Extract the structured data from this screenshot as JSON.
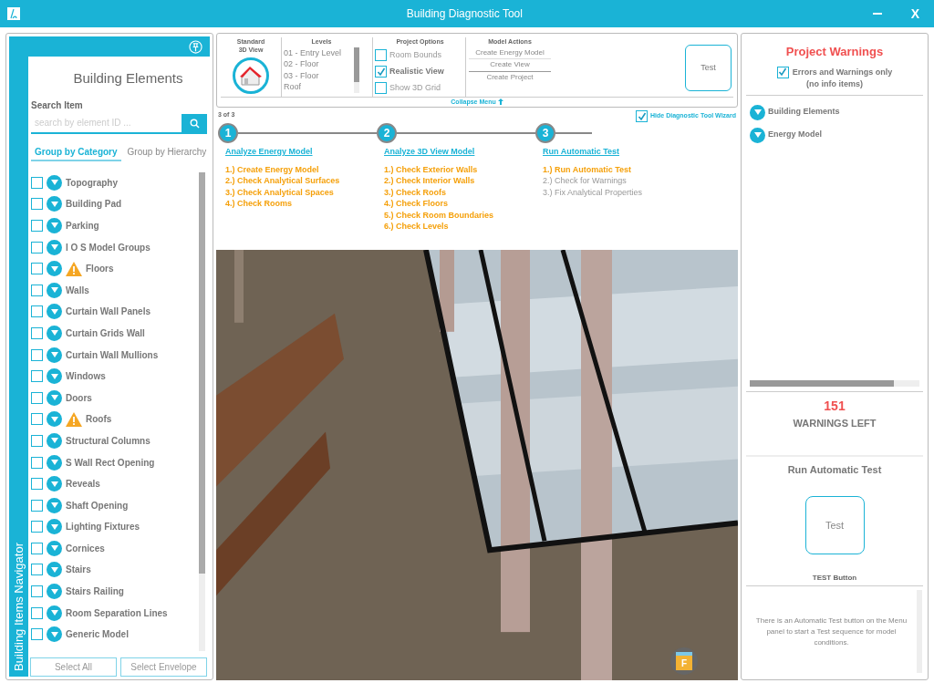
{
  "window": {
    "title": "Building Diagnostic Tool",
    "close": "X"
  },
  "navigator": {
    "side_label": "Building Items Navigator",
    "title": "Building Elements",
    "search_label": "Search Item",
    "search": {
      "placeholder": "search by element ID ..."
    },
    "tabs": [
      {
        "label": "Group by Category",
        "selected": true
      },
      {
        "label": "Group by Hierarchy",
        "selected": false
      }
    ],
    "items": [
      {
        "label": "Topography",
        "checked": false,
        "warning": false
      },
      {
        "label": "Building Pad",
        "checked": false,
        "warning": false
      },
      {
        "label": "Parking",
        "checked": false,
        "warning": false
      },
      {
        "label": "I O S Model Groups",
        "checked": false,
        "warning": false
      },
      {
        "label": "Floors",
        "checked": false,
        "warning": true
      },
      {
        "label": "Walls",
        "checked": false,
        "warning": false
      },
      {
        "label": "Curtain Wall Panels",
        "checked": false,
        "warning": false
      },
      {
        "label": "Curtain Grids Wall",
        "checked": false,
        "warning": false
      },
      {
        "label": "Curtain Wall Mullions",
        "checked": false,
        "warning": false
      },
      {
        "label": "Windows",
        "checked": false,
        "warning": false
      },
      {
        "label": "Doors",
        "checked": false,
        "warning": false
      },
      {
        "label": "Roofs",
        "checked": false,
        "warning": true
      },
      {
        "label": "Structural Columns",
        "checked": false,
        "warning": false
      },
      {
        "label": "S Wall Rect Opening",
        "checked": false,
        "warning": false
      },
      {
        "label": "Reveals",
        "checked": false,
        "warning": false
      },
      {
        "label": "Shaft Opening",
        "checked": false,
        "warning": false
      },
      {
        "label": "Lighting Fixtures",
        "checked": false,
        "warning": false
      },
      {
        "label": "Cornices",
        "checked": false,
        "warning": false
      },
      {
        "label": "Stairs",
        "checked": false,
        "warning": false
      },
      {
        "label": "Stairs Railing",
        "checked": false,
        "warning": false
      },
      {
        "label": "Room Separation Lines",
        "checked": false,
        "warning": false
      },
      {
        "label": "Generic Model",
        "checked": false,
        "warning": false
      }
    ],
    "buttons": [
      "Select All",
      "Select Envelope"
    ]
  },
  "menu": {
    "standard_view": "Standard 3D View",
    "levels_title": "Levels",
    "levels": [
      "01 - Entry Level",
      "02 - Floor",
      "03 - Floor",
      "Roof"
    ],
    "options_title": "Project Options",
    "options": [
      {
        "label": "Room Bounds",
        "checked": false
      },
      {
        "label": "Realistic View",
        "checked": true
      },
      {
        "label": "Show 3D Grid",
        "checked": false
      }
    ],
    "actions_title": "Model Actions",
    "actions": [
      "Create Energy Model",
      "Create View",
      "Create Project"
    ],
    "test_button": "Test",
    "collapse": "Collapse Menu"
  },
  "wizard": {
    "page": "3 of 3",
    "hide": {
      "label": "Hide Diagnostic Tool Wizard",
      "checked": true
    },
    "steps": [
      {
        "number": "1",
        "title": "Analyze Energy Model",
        "tasks": [
          {
            "label": "1.) Create Energy Model",
            "done": true
          },
          {
            "label": "2.) Check Analytical Surfaces",
            "done": true
          },
          {
            "label": "3.) Check Analytical Spaces",
            "done": true
          },
          {
            "label": "4.) Check Rooms",
            "done": true
          }
        ]
      },
      {
        "number": "2",
        "title": "Analyze 3D View Model",
        "tasks": [
          {
            "label": "1.) Check Exterior Walls",
            "done": true
          },
          {
            "label": "2.) Check Interior Walls",
            "done": true
          },
          {
            "label": "3.) Check Roofs",
            "done": true
          },
          {
            "label": "4.) Check Floors",
            "done": true
          },
          {
            "label": "5.) Check Room Boundaries",
            "done": true
          },
          {
            "label": "6.) Check Levels",
            "done": true
          }
        ]
      },
      {
        "number": "3",
        "title": "Run Automatic Test",
        "tasks": [
          {
            "label": "1.) Run Automatic Test",
            "done": true
          },
          {
            "label": "2.) Check for Warnings",
            "done": false
          },
          {
            "label": "3.) Fix Analytical Properties",
            "done": false
          }
        ]
      }
    ]
  },
  "viewport": {
    "kind": "picture",
    "view_cube": "F"
  },
  "warnings": {
    "title": "Project Warnings",
    "filter": {
      "label": "Errors and Warnings only",
      "note": "(no info items)",
      "checked": true
    },
    "groups": [
      "Building Elements",
      "Energy Model"
    ],
    "progress": {
      "level": 0.85
    },
    "count": "151",
    "count_label": "WARNINGS LEFT",
    "test_title": "Run Automatic Test",
    "test_button": "Test",
    "test_caption": "TEST Button",
    "description": "There is an Automatic Test button on the Menu panel to start a Test sequence for model conditions."
  }
}
